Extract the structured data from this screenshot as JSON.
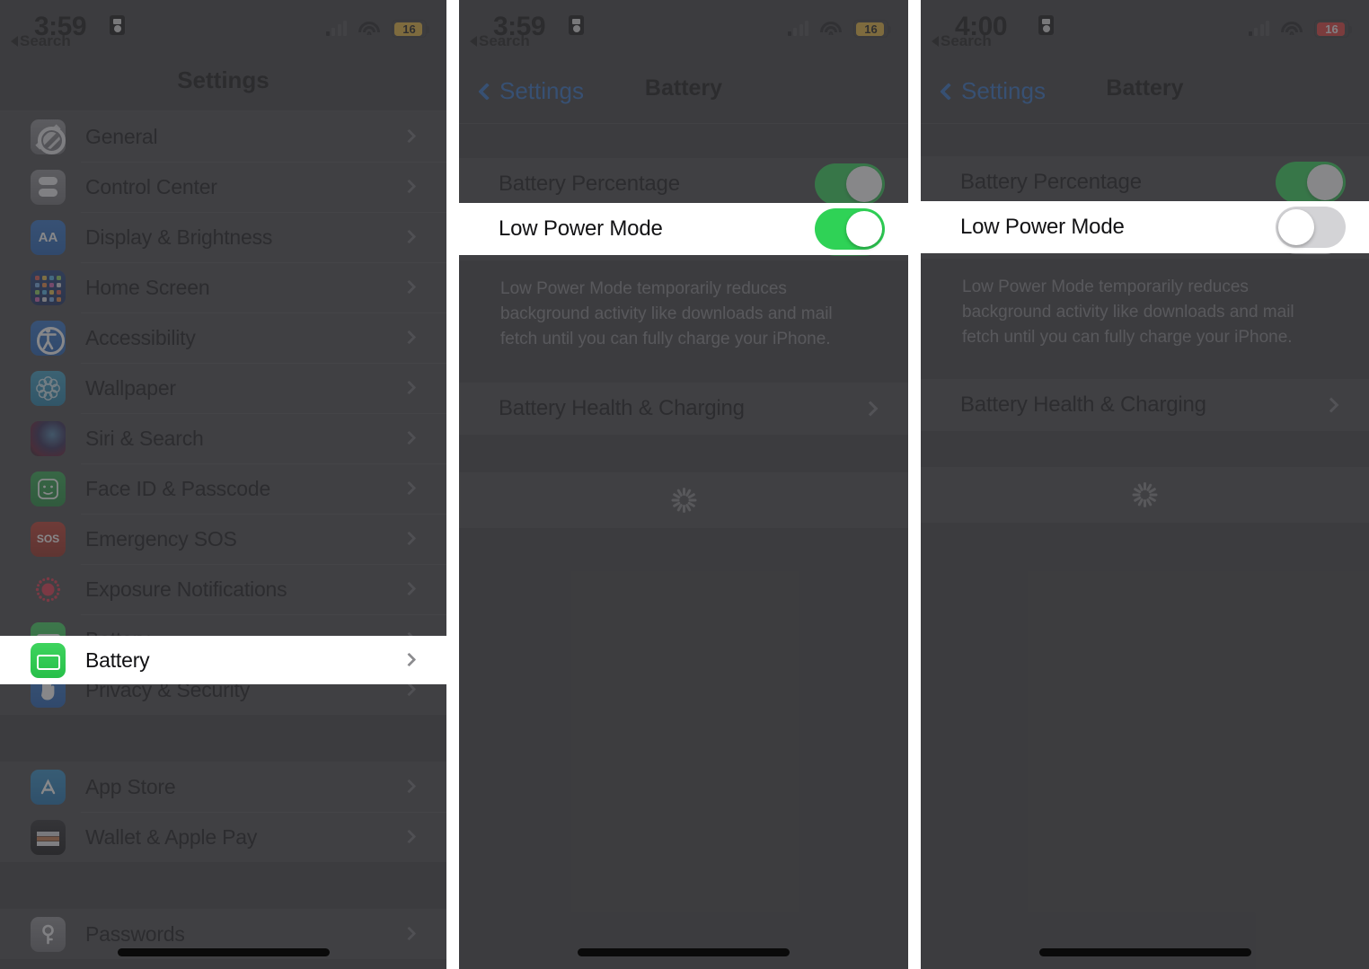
{
  "panels": [
    {
      "id": "settings-list",
      "status": {
        "time": "3:59",
        "back_label": "Search",
        "battery_level": "16",
        "battery_color": "#e8b63a",
        "lock_icon": "lock-portrait-icon",
        "wifi_icon": "wifi-icon",
        "cellular_icon": "cellular-bars-icon"
      },
      "title": "Settings",
      "groups": [
        {
          "items": [
            {
              "label": "General",
              "icon": "gear-icon",
              "icon_class": "ic-general"
            },
            {
              "label": "Control Center",
              "icon": "control-center-icon",
              "icon_class": "ic-control"
            },
            {
              "label": "Display & Brightness",
              "icon": "aa-text-icon",
              "icon_class": "ic-display",
              "glyph": "AA"
            },
            {
              "label": "Home Screen",
              "icon": "home-screen-grid-icon",
              "icon_class": "ic-home"
            },
            {
              "label": "Accessibility",
              "icon": "accessibility-icon",
              "icon_class": "ic-acc"
            },
            {
              "label": "Wallpaper",
              "icon": "wallpaper-flower-icon",
              "icon_class": "ic-wall"
            },
            {
              "label": "Siri & Search",
              "icon": "siri-orb-icon",
              "icon_class": "ic-siri"
            },
            {
              "label": "Face ID & Passcode",
              "icon": "face-id-icon",
              "icon_class": "ic-face"
            },
            {
              "label": "Emergency SOS",
              "icon": "sos-icon",
              "icon_class": "ic-sos",
              "glyph": "SOS"
            },
            {
              "label": "Exposure Notifications",
              "icon": "exposure-notifications-icon",
              "icon_class": "ic-expo"
            },
            {
              "label": "Battery",
              "icon": "battery-icon",
              "icon_class": "ic-batt",
              "highlighted": true
            },
            {
              "label": "Privacy & Security",
              "icon": "hand-privacy-icon",
              "icon_class": "ic-priv"
            }
          ]
        },
        {
          "items": [
            {
              "label": "App Store",
              "icon": "app-store-icon",
              "icon_class": "ic-appstore"
            },
            {
              "label": "Wallet & Apple Pay",
              "icon": "wallet-icon",
              "icon_class": "ic-wallet"
            }
          ]
        },
        {
          "items": [
            {
              "label": "Passwords",
              "icon": "key-passwords-icon",
              "icon_class": "ic-pass"
            }
          ]
        }
      ]
    },
    {
      "id": "battery-lpm-on",
      "status": {
        "time": "3:59",
        "back_label": "Search",
        "battery_level": "16",
        "battery_color": "#e8b63a",
        "lock_icon": "lock-portrait-icon",
        "wifi_icon": "wifi-icon",
        "cellular_icon": "cellular-bars-icon"
      },
      "nav": {
        "back_label": "Settings",
        "title": "Battery"
      },
      "rows": [
        {
          "label": "Battery Percentage",
          "toggle": "on"
        },
        {
          "label": "Low Power Mode",
          "toggle": "on",
          "highlighted": true
        }
      ],
      "footnote": "Low Power Mode temporarily reduces background activity like downloads and mail fetch until you can fully charge your iPhone.",
      "link_label": "Battery Health & Charging",
      "loading_icon": "loading-spinner-icon"
    },
    {
      "id": "battery-lpm-off",
      "status": {
        "time": "4:00",
        "back_label": "Search",
        "battery_level": "16",
        "battery_color": "#e03b38",
        "lock_icon": "lock-portrait-icon",
        "wifi_icon": "wifi-icon",
        "cellular_icon": "cellular-bars-icon"
      },
      "nav": {
        "back_label": "Settings",
        "title": "Battery"
      },
      "rows": [
        {
          "label": "Battery Percentage",
          "toggle": "on"
        },
        {
          "label": "Low Power Mode",
          "toggle": "off",
          "highlighted": true
        }
      ],
      "footnote": "Low Power Mode temporarily reduces background activity like downloads and mail fetch until you can fully charge your iPhone.",
      "link_label": "Battery Health & Charging",
      "loading_icon": "loading-spinner-icon"
    }
  ],
  "colors": {
    "accent_blue": "#2f6fc4",
    "toggle_on": "#2fd256",
    "toggle_off": "#d3d3d6",
    "battery_green": "#2fbf4a"
  }
}
